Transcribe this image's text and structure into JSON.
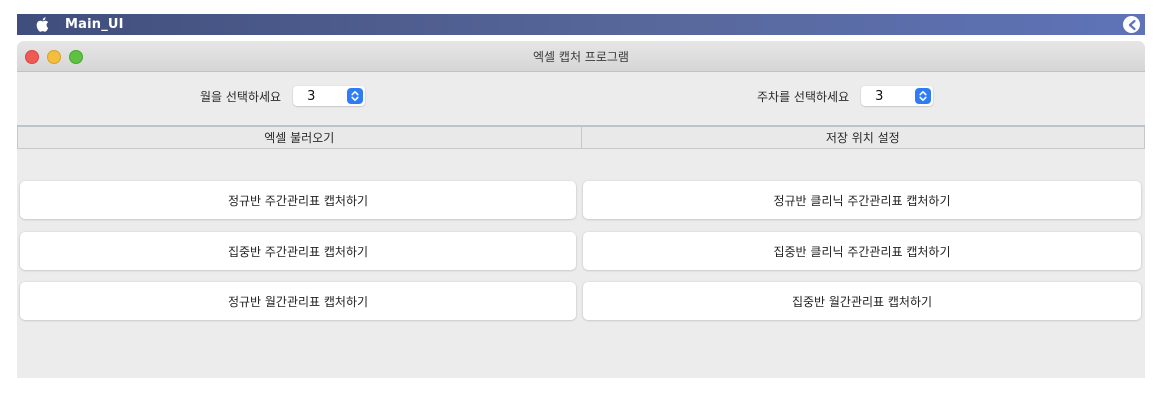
{
  "menubar": {
    "app_name": "Main_UI",
    "apple_icon": "apple-logo-icon",
    "status_icon": "status-menu-icon"
  },
  "window": {
    "title": "엑셀 캡처 프로그램"
  },
  "month_selector": {
    "label": "월을 선택하세요",
    "value": "3"
  },
  "week_selector": {
    "label": "주차를 선택하세요",
    "value": "3"
  },
  "tabs": [
    {
      "label": "엑셀 불러오기"
    },
    {
      "label": "저장 위치 설정"
    }
  ],
  "buttons": {
    "regular_weekly": "정규반 주간관리표 캡처하기",
    "regular_clinic_weekly": "정규반 클리닉 주간관리표 캡처하기",
    "intensive_weekly": "집중반 주간관리표 캡처하기",
    "intensive_clinic_weekly": "집중반 클리닉 주간관리표 캡처하기",
    "regular_monthly": "정규반 월간관리표 캡처하기",
    "intensive_monthly": "집중반 월간관리표 캡처하기"
  },
  "colors": {
    "accent": "#2f7df6",
    "menubar": "#4a5888",
    "window_bg": "#ececec"
  }
}
